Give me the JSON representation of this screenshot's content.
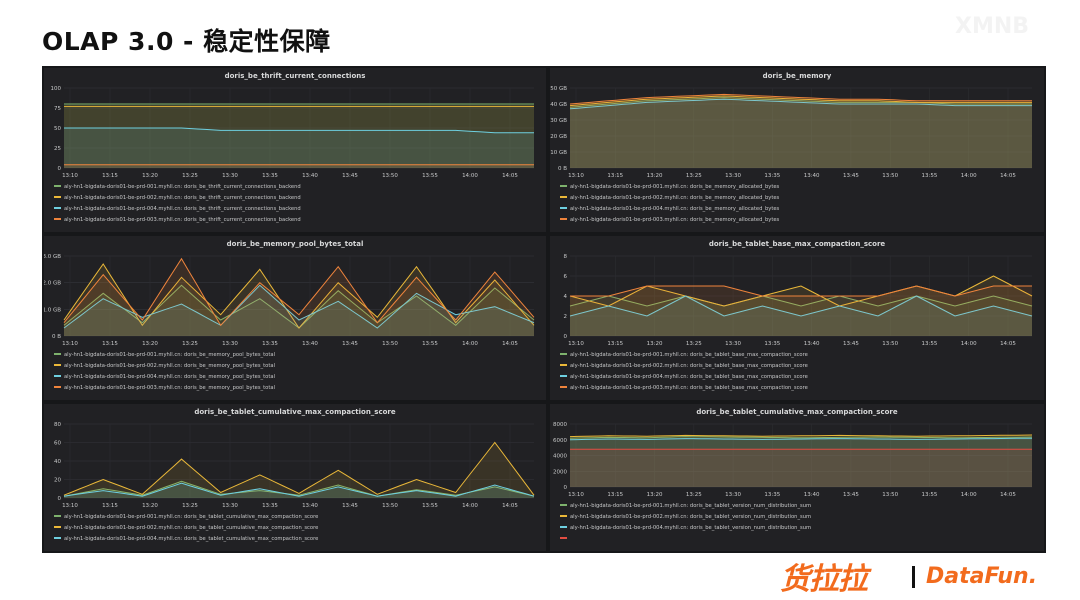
{
  "page": {
    "title": "OLAP 3.0 - 稳定性保障",
    "watermark": "XMNB",
    "brand_cn": "货拉拉",
    "brand_en": "DataFun."
  },
  "colors": {
    "green": "#7eb26d",
    "yellow": "#eab839",
    "cyan": "#6ed0e0",
    "orange": "#ef843c",
    "pink": "#e24d42"
  },
  "x_ticks": [
    "13:10",
    "13:15",
    "13:20",
    "13:25",
    "13:30",
    "13:35",
    "13:40",
    "13:45",
    "13:50",
    "13:55",
    "14:00",
    "14:05"
  ],
  "chart_data": [
    {
      "type": "line",
      "title": "doris_be_thrift_current_connections",
      "yticks": [
        "0",
        "25",
        "50",
        "75",
        "100"
      ],
      "ylim": [
        0,
        100
      ],
      "series": [
        {
          "name": "aly-hn1-bigdata-doris01-be-prd-001.myhll.cn: doris_be_thrift_current_connections_backend",
          "color": "green",
          "values": [
            80,
            80,
            80,
            80,
            80,
            80,
            80,
            80,
            80,
            80,
            80,
            80,
            80
          ]
        },
        {
          "name": "aly-hn1-bigdata-doris01-be-prd-002.myhll.cn: doris_be_thrift_current_connections_backend",
          "color": "yellow",
          "values": [
            77,
            77,
            77,
            77,
            77,
            77,
            77,
            77,
            77,
            77,
            77,
            77,
            77
          ]
        },
        {
          "name": "aly-hn1-bigdata-doris01-be-prd-004.myhll.cn: doris_be_thrift_current_connections_backend",
          "color": "cyan",
          "values": [
            50,
            50,
            50,
            50,
            47,
            47,
            47,
            47,
            47,
            47,
            47,
            44,
            44
          ]
        },
        {
          "name": "aly-hn1-bigdata-doris01-be-prd-003.myhll.cn: doris_be_thrift_current_connections_backend",
          "color": "orange",
          "values": [
            4,
            4,
            4,
            4,
            4,
            4,
            4,
            4,
            4,
            4,
            4,
            4,
            4
          ]
        }
      ]
    },
    {
      "type": "line",
      "title": "doris_be_memory",
      "yticks": [
        "0 B",
        "10 GB",
        "20 GB",
        "30 GB",
        "40 GB",
        "50 GB"
      ],
      "ylim": [
        0,
        50
      ],
      "series": [
        {
          "name": "aly-hn1-bigdata-doris01-be-prd-001.myhll.cn: doris_be_memory_allocated_bytes",
          "color": "green",
          "values": [
            38,
            40,
            42,
            43,
            44,
            43,
            42,
            41,
            41,
            41,
            40,
            40,
            40
          ]
        },
        {
          "name": "aly-hn1-bigdata-doris01-be-prd-002.myhll.cn: doris_be_memory_allocated_bytes",
          "color": "yellow",
          "values": [
            39,
            41,
            43,
            44,
            45,
            44,
            43,
            42,
            42,
            41,
            41,
            41,
            41
          ]
        },
        {
          "name": "aly-hn1-bigdata-doris01-be-prd-004.myhll.cn: doris_be_memory_allocated_bytes",
          "color": "cyan",
          "values": [
            37,
            39,
            41,
            42,
            43,
            42,
            41,
            40,
            40,
            40,
            39,
            39,
            39
          ]
        },
        {
          "name": "aly-hn1-bigdata-doris01-be-prd-003.myhll.cn: doris_be_memory_allocated_bytes",
          "color": "orange",
          "values": [
            40,
            42,
            44,
            45,
            46,
            45,
            44,
            43,
            43,
            42,
            42,
            42,
            42
          ]
        }
      ]
    },
    {
      "type": "line",
      "title": "doris_be_memory_pool_bytes_total",
      "yticks": [
        "0 B",
        "1.0 GB",
        "2.0 GB",
        "3.0 GB"
      ],
      "ylim": [
        0,
        3
      ],
      "series": [
        {
          "name": "aly-hn1-bigdata-doris01-be-prd-001.myhll.cn: doris_be_memory_pool_bytes_total",
          "color": "green",
          "values": [
            0.4,
            1.6,
            0.5,
            1.9,
            0.6,
            1.4,
            0.3,
            1.7,
            0.5,
            1.5,
            0.4,
            1.8,
            0.6
          ]
        },
        {
          "name": "aly-hn1-bigdata-doris01-be-prd-002.myhll.cn: doris_be_memory_pool_bytes_total",
          "color": "yellow",
          "values": [
            0.6,
            2.7,
            0.4,
            2.2,
            0.8,
            2.5,
            0.3,
            2.0,
            0.7,
            2.6,
            0.5,
            2.1,
            0.4
          ]
        },
        {
          "name": "aly-hn1-bigdata-doris01-be-prd-004.myhll.cn: doris_be_memory_pool_bytes_total",
          "color": "cyan",
          "values": [
            0.3,
            1.4,
            0.7,
            1.2,
            0.4,
            1.9,
            0.6,
            1.3,
            0.3,
            1.6,
            0.8,
            1.1,
            0.5
          ]
        },
        {
          "name": "aly-hn1-bigdata-doris01-be-prd-003.myhll.cn: doris_be_memory_pool_bytes_total",
          "color": "orange",
          "values": [
            0.5,
            2.3,
            0.6,
            2.9,
            0.4,
            2.0,
            0.8,
            2.6,
            0.5,
            2.2,
            0.6,
            2.4,
            0.7
          ]
        }
      ]
    },
    {
      "type": "line",
      "title": "doris_be_tablet_base_max_compaction_score",
      "yticks": [
        "0",
        "2",
        "4",
        "6",
        "8"
      ],
      "ylim": [
        0,
        8
      ],
      "series": [
        {
          "name": "aly-hn1-bigdata-doris01-be-prd-001.myhll.cn: doris_be_tablet_base_max_compaction_score",
          "color": "green",
          "values": [
            3,
            4,
            3,
            4,
            3,
            4,
            3,
            4,
            3,
            4,
            3,
            4,
            3
          ]
        },
        {
          "name": "aly-hn1-bigdata-doris01-be-prd-002.myhll.cn: doris_be_tablet_base_max_compaction_score",
          "color": "yellow",
          "values": [
            4,
            3,
            5,
            4,
            3,
            4,
            5,
            3,
            4,
            5,
            4,
            6,
            4
          ]
        },
        {
          "name": "aly-hn1-bigdata-doris01-be-prd-004.myhll.cn: doris_be_tablet_base_max_compaction_score",
          "color": "cyan",
          "values": [
            2,
            3,
            2,
            4,
            2,
            3,
            2,
            3,
            2,
            4,
            2,
            3,
            2
          ]
        },
        {
          "name": "aly-hn1-bigdata-doris01-be-prd-003.myhll.cn: doris_be_tablet_base_max_compaction_score",
          "color": "orange",
          "values": [
            4,
            4,
            5,
            5,
            5,
            4,
            4,
            4,
            4,
            5,
            4,
            5,
            5
          ]
        }
      ]
    },
    {
      "type": "line",
      "title": "doris_be_tablet_cumulative_max_compaction_score",
      "yticks": [
        "0",
        "20",
        "40",
        "60",
        "80"
      ],
      "ylim": [
        0,
        80
      ],
      "series": [
        {
          "name": "aly-hn1-bigdata-doris01-be-prd-001.myhll.cn: doris_be_tablet_cumulative_max_compaction_score",
          "color": "green",
          "values": [
            2,
            10,
            3,
            18,
            4,
            8,
            3,
            14,
            2,
            9,
            3,
            12,
            2
          ]
        },
        {
          "name": "aly-hn1-bigdata-doris01-be-prd-002.myhll.cn: doris_be_tablet_cumulative_max_compaction_score",
          "color": "yellow",
          "values": [
            3,
            20,
            4,
            42,
            6,
            25,
            5,
            30,
            4,
            20,
            6,
            60,
            3
          ]
        },
        {
          "name": "aly-hn1-bigdata-doris01-be-prd-004.myhll.cn: doris_be_tablet_cumulative_max_compaction_score",
          "color": "cyan",
          "values": [
            2,
            8,
            2,
            16,
            3,
            10,
            2,
            12,
            2,
            8,
            2,
            14,
            2
          ]
        }
      ]
    },
    {
      "type": "line",
      "title": "doris_be_tablet_cumulative_max_compaction_score",
      "yticks": [
        "0",
        "2000",
        "4000",
        "6000",
        "8000"
      ],
      "ylim": [
        0,
        8000
      ],
      "series": [
        {
          "name": "aly-hn1-bigdata-doris01-be-prd-001.myhll.cn: doris_be_tablet_version_num_distribution_sum",
          "color": "green",
          "values": [
            6200,
            6300,
            6250,
            6400,
            6350,
            6300,
            6250,
            6300,
            6350,
            6300,
            6250,
            6300,
            6350
          ]
        },
        {
          "name": "aly-hn1-bigdata-doris01-be-prd-002.myhll.cn: doris_be_tablet_version_num_distribution_sum",
          "color": "yellow",
          "values": [
            6400,
            6500,
            6450,
            6550,
            6500,
            6450,
            6500,
            6550,
            6500,
            6450,
            6500,
            6550,
            6600
          ]
        },
        {
          "name": "aly-hn1-bigdata-doris01-be-prd-004.myhll.cn: doris_be_tablet_version_num_distribution_sum",
          "color": "cyan",
          "values": [
            6000,
            6100,
            6050,
            6150,
            6100,
            6050,
            6100,
            6150,
            6100,
            6050,
            6100,
            6150,
            6200
          ]
        },
        {
          "name": "",
          "color": "pink",
          "values": [
            4800,
            4800,
            4800,
            4800,
            4800,
            4800,
            4800,
            4800,
            4800,
            4800,
            4800,
            4800,
            4800
          ]
        }
      ]
    }
  ]
}
